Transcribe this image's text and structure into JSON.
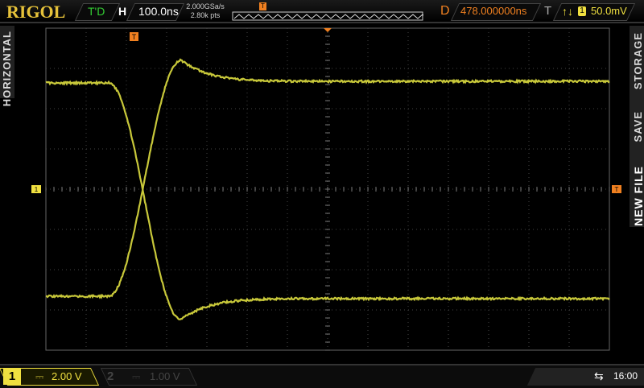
{
  "brand": "RIGOL",
  "header": {
    "mode": "T'D",
    "h_label": "H",
    "timebase": "100.0ns",
    "sample_rate": "2.000GSa/s",
    "memory_depth": "2.80k pts",
    "d_label": "D",
    "delay": "478.000000ns",
    "t_label": "T",
    "trigger_slope": "↑↓",
    "trigger_source": "1",
    "trigger_level": "50.0mV"
  },
  "side_left": {
    "menu": "HORIZONTAL"
  },
  "side_right": {
    "menu1": "STORAGE",
    "menu2": "SAVE",
    "menu3": "NEW FILE"
  },
  "markers": {
    "trigger": "T",
    "channel1": "1"
  },
  "footer": {
    "ch1_num": "1",
    "ch1_coupling": "⎓",
    "ch1_scale": "2.00 V",
    "ch2_num": "2",
    "ch2_coupling": "⎓",
    "ch2_scale": "1.00 V",
    "usb": "⇆",
    "time": "16:00"
  },
  "colors": {
    "ch1": "#c8c83a",
    "accent": "#f08020",
    "ch1_badge": "#f0e040"
  }
}
